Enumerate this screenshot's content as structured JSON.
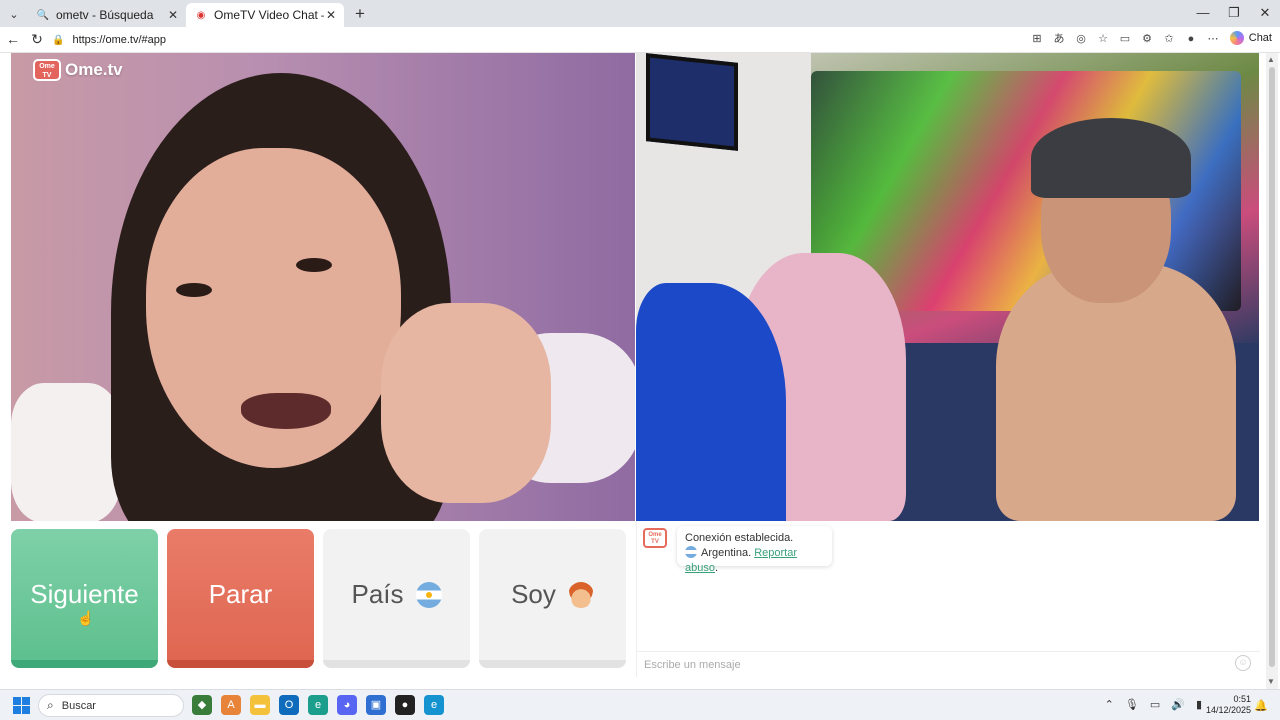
{
  "browser": {
    "tabs": [
      {
        "title": "ometv - Búsqueda",
        "icon": "search-icon"
      },
      {
        "title": "OmeTV Video Chat — Omegle",
        "icon": "record-icon",
        "active": true
      }
    ],
    "url": "https://ome.tv/#app",
    "chat_label": "Chat"
  },
  "app": {
    "logo_text": "Ome.tv",
    "logo_badge": "Ome TV",
    "buttons": {
      "next": "Siguiente",
      "stop": "Parar",
      "country": "País",
      "gender": "Soy"
    },
    "chat": {
      "status": "Conexión establecida.",
      "country": "Argentina.",
      "report_link": "Reportar abuso",
      "report_suffix": ".",
      "input_placeholder": "Escribe un mensaje"
    }
  },
  "taskbar": {
    "search_placeholder": "Buscar",
    "time": "0:51",
    "date": "14/12/2025"
  },
  "colors": {
    "next_button": "#5ec08e",
    "stop_button": "#df6752",
    "link": "#3aa17a"
  }
}
